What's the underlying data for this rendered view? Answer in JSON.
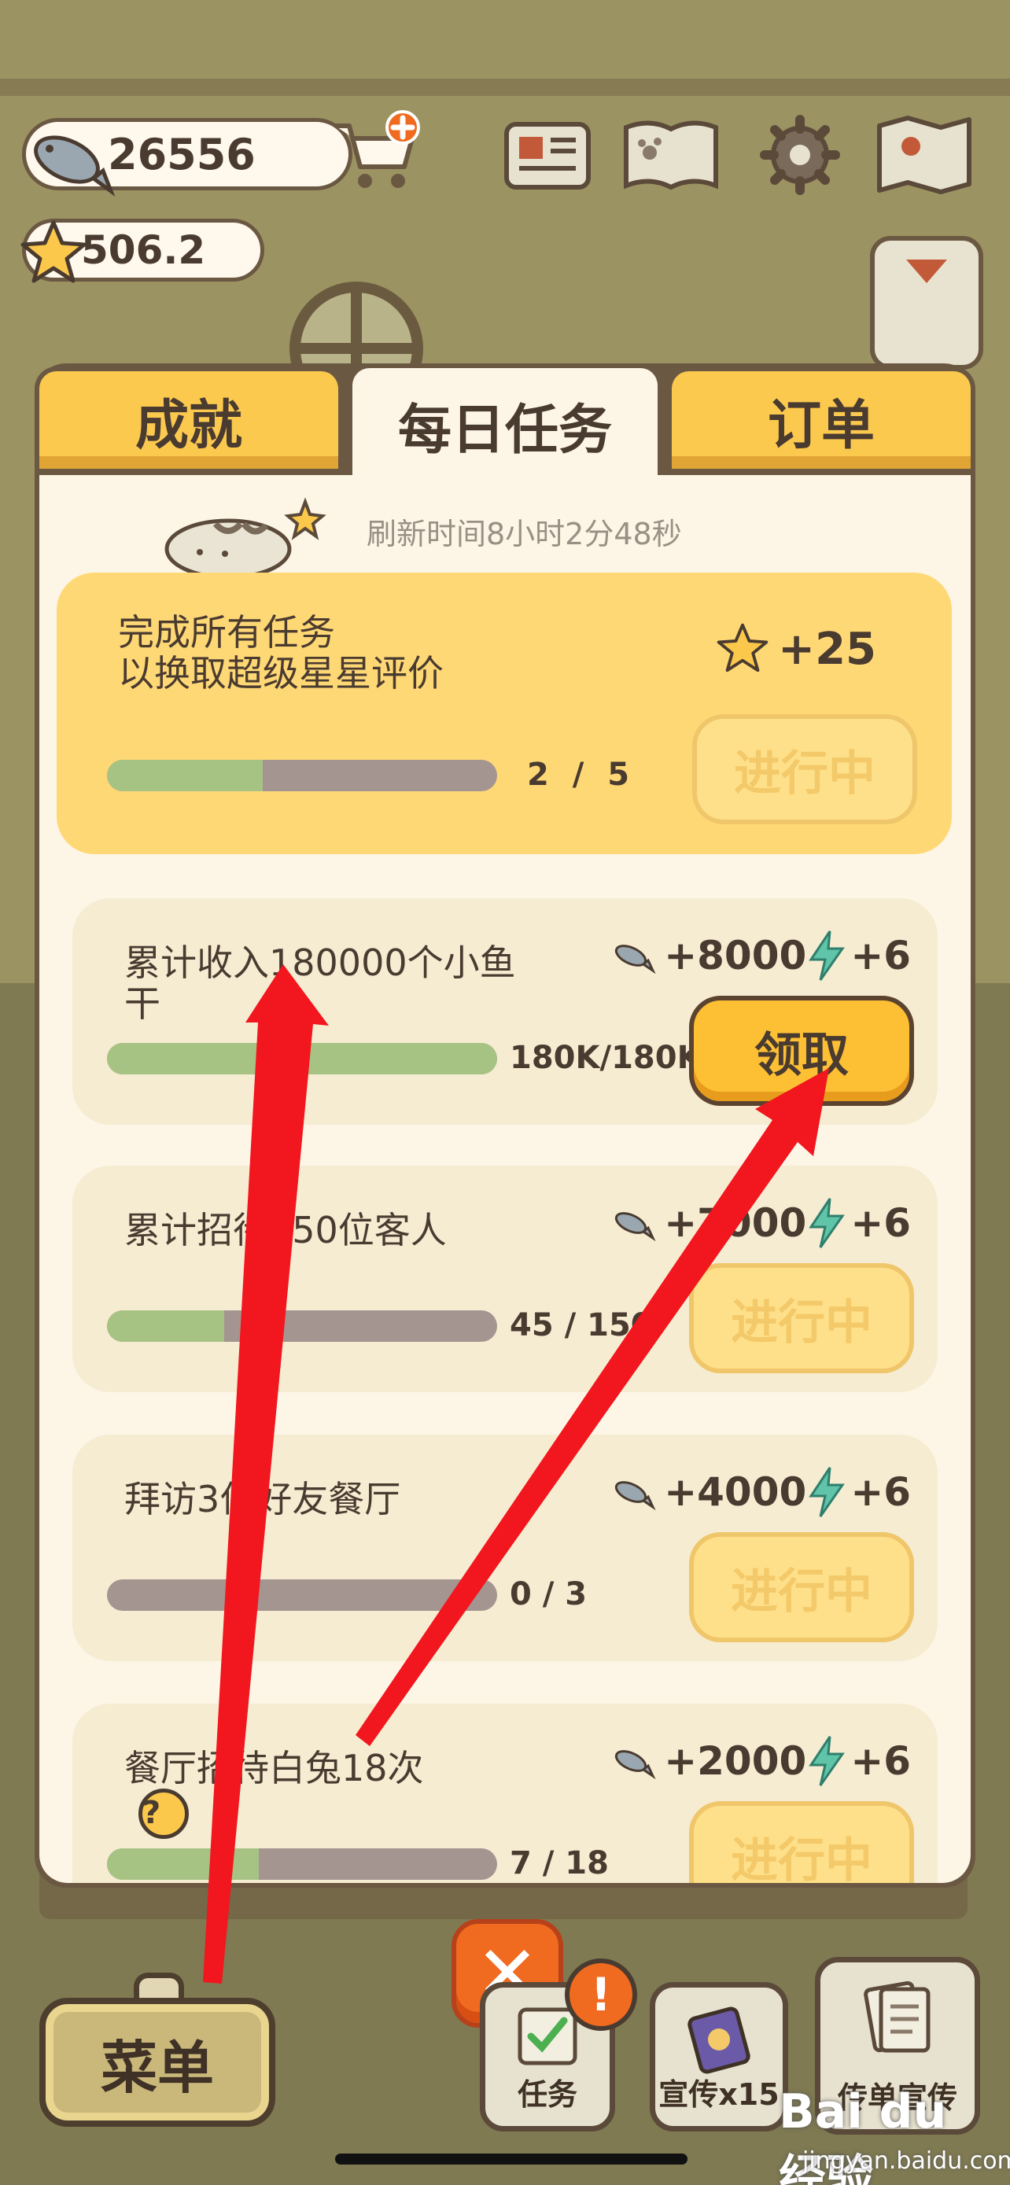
{
  "hud": {
    "fish_amount": "26556",
    "star_amount": "506.2",
    "icons": [
      "fish-icon",
      "star-icon",
      "cart-plus-icon",
      "newspaper-icon",
      "paw-book-icon",
      "gear-icon",
      "map-icon"
    ]
  },
  "tabs": [
    {
      "label": "成就",
      "active": false
    },
    {
      "label": "每日任务",
      "active": true
    },
    {
      "label": "订单",
      "active": false
    }
  ],
  "refresh_text": "刷新时间8小时2分48秒",
  "master_task": {
    "title_line1": "完成所有任务",
    "title_line2": "以换取超级星星评价",
    "reward": "+25",
    "progress_text": "2 / 5",
    "progress": 0.4,
    "button": "进行中"
  },
  "tasks": [
    {
      "title_line1": "累计收入180000个小鱼",
      "title_line2": "干",
      "fish_reward": "+8000",
      "energy_reward": "+6",
      "progress_text": "180K/180K",
      "progress": 1.0,
      "button": "领取",
      "claimable": true
    },
    {
      "title_line1": "累计招待150位客人",
      "title_line2": "",
      "fish_reward": "+7000",
      "energy_reward": "+6",
      "progress_text": "45 / 150",
      "progress": 0.3,
      "button": "进行中",
      "claimable": false
    },
    {
      "title_line1": "拜访3位好友餐厅",
      "title_line2": "",
      "fish_reward": "+4000",
      "energy_reward": "+6",
      "progress_text": "0 / 3",
      "progress": 0.0,
      "button": "进行中",
      "claimable": false
    },
    {
      "title_line1": "餐厅招待白兔18次",
      "title_line2": "",
      "help": "?",
      "fish_reward": "+2000",
      "energy_reward": "+6",
      "progress_text": "7 / 18",
      "progress": 0.39,
      "button": "进行中",
      "claimable": false
    }
  ],
  "bottom": {
    "close_label": "✕",
    "menu_label": "菜单",
    "task_label": "任务",
    "promo_label": "宣传x15",
    "flyer_label": "传单宣传",
    "alert_badge": "!"
  },
  "watermark": {
    "text": "Bai du 经验",
    "url": "jingyan.baidu.com"
  },
  "colors": {
    "accent_yellow": "#fbc94e",
    "claim_button": "#fdbf33",
    "progress_fill": "#a7c384",
    "progress_track": "#a59591",
    "close_orange": "#f06a1f",
    "annotation_red": "#f2161e"
  }
}
